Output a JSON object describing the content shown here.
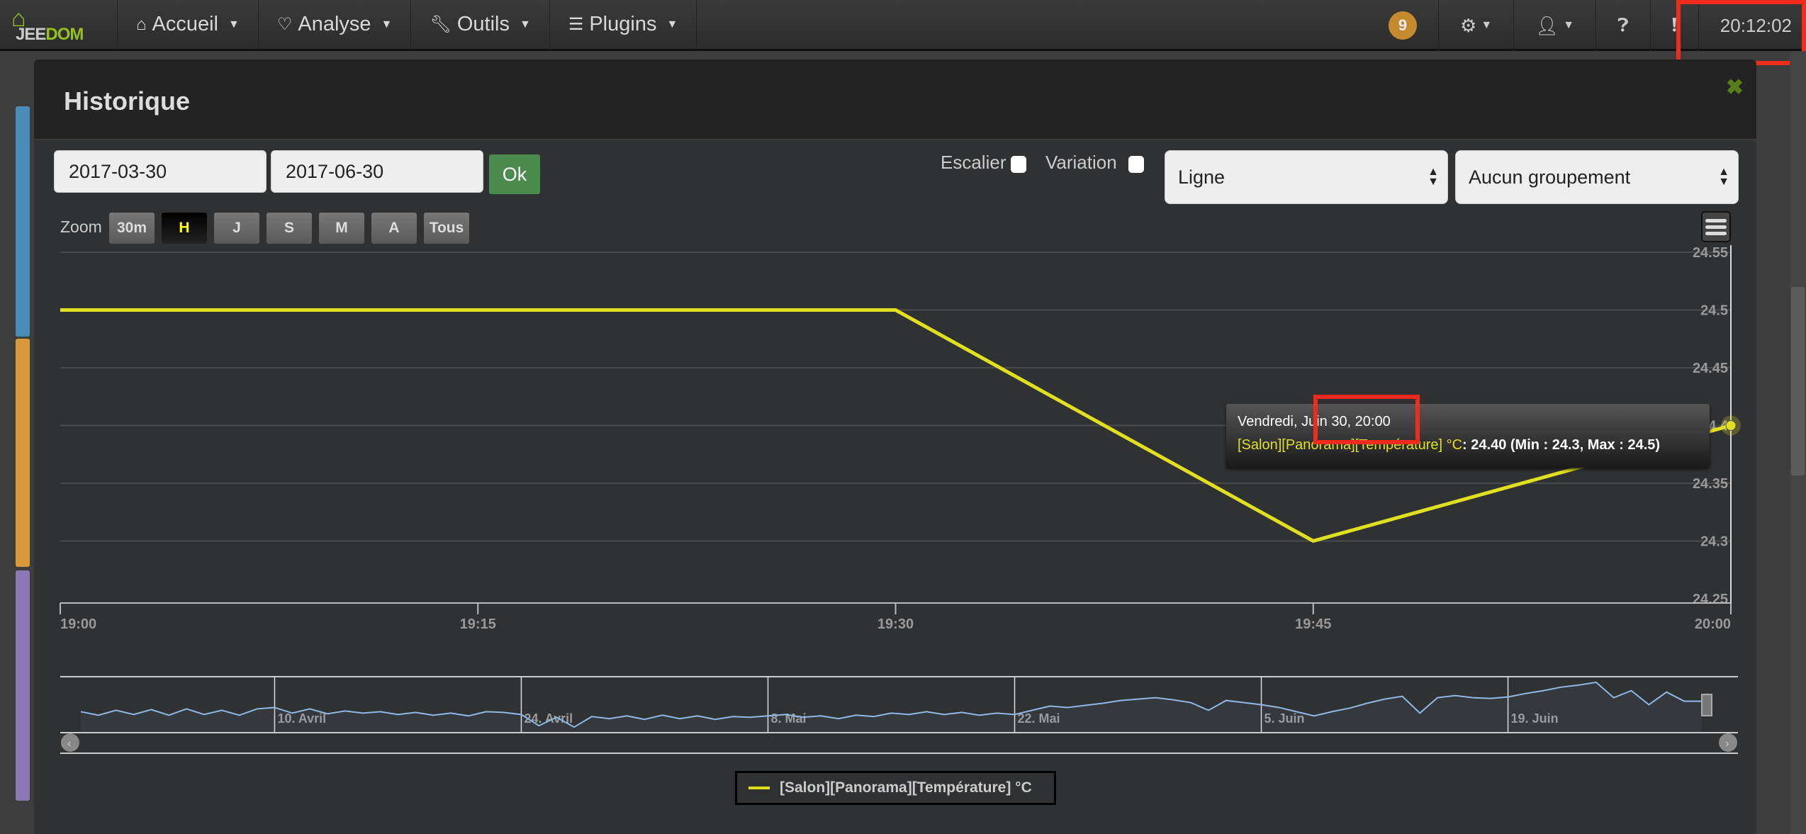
{
  "navbar": {
    "logo": "JEEDOM",
    "menus": [
      {
        "icon": "home-icon",
        "label": "Accueil"
      },
      {
        "icon": "stethoscope-icon",
        "label": "Analyse"
      },
      {
        "icon": "wrench-icon",
        "label": "Outils"
      },
      {
        "icon": "server-icon",
        "label": "Plugins"
      }
    ],
    "badge_count": "9",
    "clock": "20:12:02"
  },
  "modal": {
    "title": "Historique",
    "start_date": "2017-03-30",
    "end_date": "2017-06-30",
    "ok_label": "Ok",
    "escalier_label": "Escalier",
    "escalier_checked": false,
    "variation_label": "Variation",
    "variation_checked": false,
    "chart_type": "Ligne",
    "grouping": "Aucun groupement",
    "zoom_label": "Zoom",
    "zoom_buttons": [
      "30m",
      "H",
      "J",
      "S",
      "M",
      "A",
      "Tous"
    ],
    "zoom_active": "H"
  },
  "tooltip": {
    "date": "Vendredi, Juin 30, 20:00",
    "series": "[Salon][Panorama][Température] °C",
    "value_text": ": 24.40 (Min : 24.3, Max : 24.5)"
  },
  "colors": {
    "series": "#e0e020",
    "navigator": "#8fb8e6",
    "accent": "#94c11f",
    "highlight_box": "#f02a1d"
  },
  "chart_data": {
    "type": "line",
    "series": [
      {
        "name": "[Salon][Panorama][Température] °C",
        "x": [
          "19:00",
          "19:30",
          "19:45",
          "20:00"
        ],
        "values": [
          24.5,
          24.5,
          24.3,
          24.4
        ]
      }
    ],
    "x_ticks": [
      "19:00",
      "19:15",
      "19:30",
      "19:45",
      "20:00"
    ],
    "y_ticks": [
      "24.25",
      "24.3",
      "24.35",
      "24.4",
      "24.45",
      "24.5",
      "24.55"
    ],
    "ylim": [
      24.25,
      24.55
    ],
    "xlim": [
      "19:00",
      "20:00"
    ],
    "grid": true,
    "legend": "bottom-center",
    "navigator": {
      "start": "2017-03-30",
      "end": "2017-06-30",
      "labels": [
        "10. Avril",
        "24. Avril",
        "8. Mai",
        "22. Mai",
        "5. Juin",
        "19. Juin"
      ],
      "label_days": [
        11,
        25,
        39,
        53,
        67,
        81
      ],
      "daily_values": [
        23,
        22.5,
        23.2,
        22.6,
        23.3,
        22.5,
        23.4,
        22.6,
        23.2,
        22.5,
        23.4,
        23.6,
        22.8,
        23.4,
        22.7,
        23.1,
        22.8,
        23.0,
        22.6,
        22.9,
        22.5,
        22.8,
        22.4,
        23.0,
        22.9,
        22.6,
        21.0,
        22.2,
        20.8,
        22.3,
        22.0,
        22.4,
        21.9,
        22.5,
        22.0,
        22.4,
        21.9,
        22.3,
        22.2,
        22.4,
        22.6,
        22.2,
        22.4,
        22.0,
        22.5,
        22.3,
        22.8,
        22.6,
        23.0,
        22.6,
        22.9,
        22.5,
        22.8,
        22.6,
        23.2,
        23.8,
        23.6,
        23.9,
        24.2,
        24.6,
        24.8,
        25.0,
        24.7,
        24.3,
        23.2,
        24.6,
        24.3,
        24.0,
        23.6,
        23.0,
        22.4,
        23.0,
        23.5,
        24.2,
        24.8,
        25.2,
        22.8,
        25.0,
        25.3,
        25.0,
        24.9,
        25.1,
        25.6,
        26.0,
        26.5,
        26.8,
        27.2,
        25.0,
        26.0,
        24.0,
        25.8,
        24.5,
        24.5
      ]
    }
  }
}
